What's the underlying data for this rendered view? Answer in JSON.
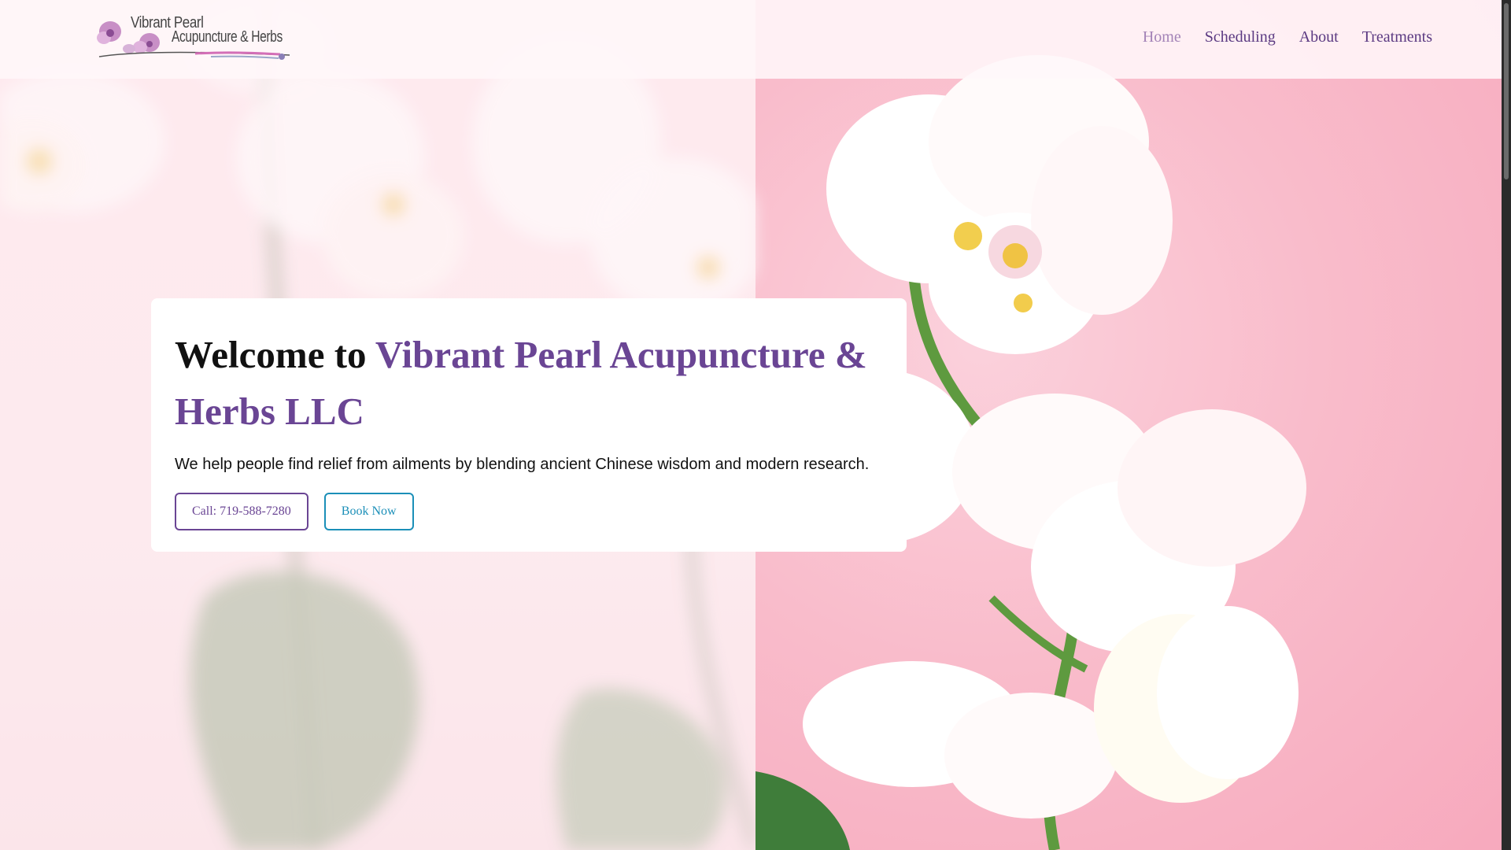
{
  "logo": {
    "line1": "Vibrant Pearl",
    "line2": "Acupuncture & Herbs"
  },
  "nav": {
    "items": [
      {
        "label": "Home",
        "active": true
      },
      {
        "label": "Scheduling",
        "active": false
      },
      {
        "label": "About",
        "active": false
      },
      {
        "label": "Treatments",
        "active": false
      }
    ]
  },
  "hero": {
    "title_prefix": "Welcome to ",
    "title_brand": "Vibrant Pearl Acupuncture & Herbs LLC",
    "subtitle": "We help people find relief from ailments by blending ancient Chinese wisdom and modern research.",
    "call_label": "Call: 719-588-7280",
    "book_label": "Book Now"
  },
  "colors": {
    "brand_purple": "#6a4594",
    "nav_purple": "#5b3a82",
    "nav_active": "#a383b7",
    "book_teal": "#1b8fb8",
    "background_pink": "#f9bccb"
  },
  "icons": [
    "orchid-logo-icon"
  ]
}
